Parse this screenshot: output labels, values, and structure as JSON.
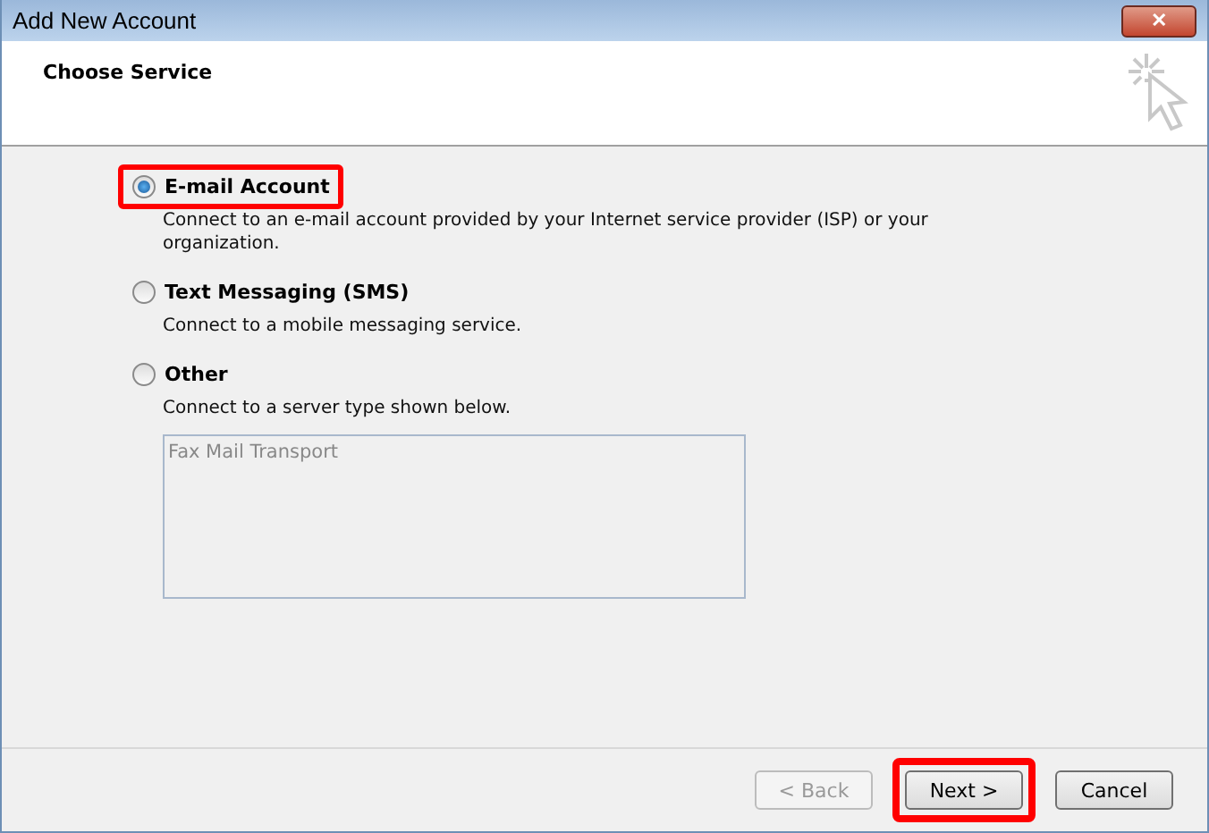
{
  "window": {
    "title": "Add New Account",
    "close": "✕"
  },
  "header": {
    "title": "Choose Service"
  },
  "options": [
    {
      "label": "E-mail Account",
      "description": "Connect to an e-mail account provided by your Internet service provider (ISP) or your organization.",
      "selected": true,
      "highlighted": true
    },
    {
      "label": "Text Messaging (SMS)",
      "description": "Connect to a mobile messaging service.",
      "selected": false,
      "highlighted": false
    },
    {
      "label": "Other",
      "description": "Connect to a server type shown below.",
      "selected": false,
      "highlighted": false
    }
  ],
  "server_types": {
    "disabled": true,
    "items": [
      "Fax Mail Transport"
    ]
  },
  "buttons": [
    {
      "label": "< Back",
      "disabled": true,
      "highlighted": false
    },
    {
      "label": "Next >",
      "disabled": false,
      "highlighted": true
    },
    {
      "label": "Cancel",
      "disabled": false,
      "highlighted": false
    }
  ]
}
